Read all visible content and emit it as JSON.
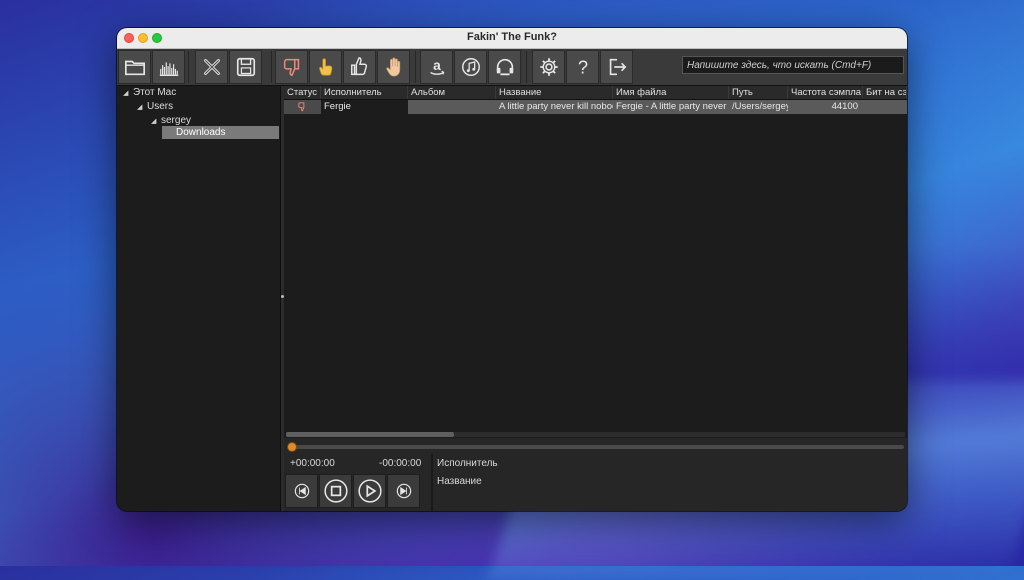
{
  "window": {
    "title": "Fakin' The Funk?"
  },
  "toolbar": {
    "buttons": [
      {
        "name": "open-folder-icon"
      },
      {
        "name": "analyze-icon"
      },
      {
        "name": "clear-icon"
      },
      {
        "name": "save-icon"
      },
      {
        "name": "thumb-down-icon"
      },
      {
        "name": "thumb-point-icon"
      },
      {
        "name": "thumb-up-icon"
      },
      {
        "name": "hand-stop-icon"
      },
      {
        "name": "amazon-icon"
      },
      {
        "name": "itunes-icon"
      },
      {
        "name": "headphones-icon"
      },
      {
        "name": "settings-icon"
      },
      {
        "name": "help-icon"
      },
      {
        "name": "exit-icon"
      }
    ],
    "search_placeholder": "Напишите здесь, что искать (Cmd+F)"
  },
  "tree": {
    "items": [
      {
        "label": "Этот Mac"
      },
      {
        "label": "Users"
      },
      {
        "label": "sergey"
      },
      {
        "label": "Downloads"
      }
    ]
  },
  "table": {
    "columns": [
      "Статус",
      "Исполнитель",
      "Альбом",
      "Название",
      "Имя файла",
      "Путь",
      "Частота сэмпла",
      "Бит на сэмпл"
    ],
    "rows": [
      {
        "status_icon": "thumb-down-icon",
        "artist": "Fergie",
        "album": "",
        "title": "A little party never kill nobody",
        "filename": "Fergie - A little party never kill nobody",
        "path": "/Users/sergey/Downloads",
        "sample_rate": "44100",
        "bits": ""
      }
    ]
  },
  "player": {
    "elapsed": "+00:00:00",
    "remaining": "-00:00:00",
    "artist_label": "Исполнитель",
    "title_label": "Название",
    "progress": 0
  },
  "colors": {
    "accent_orange": "#e08a2a",
    "toolbar_bg": "#3a3a3a",
    "selection": "#7a7a7a"
  }
}
